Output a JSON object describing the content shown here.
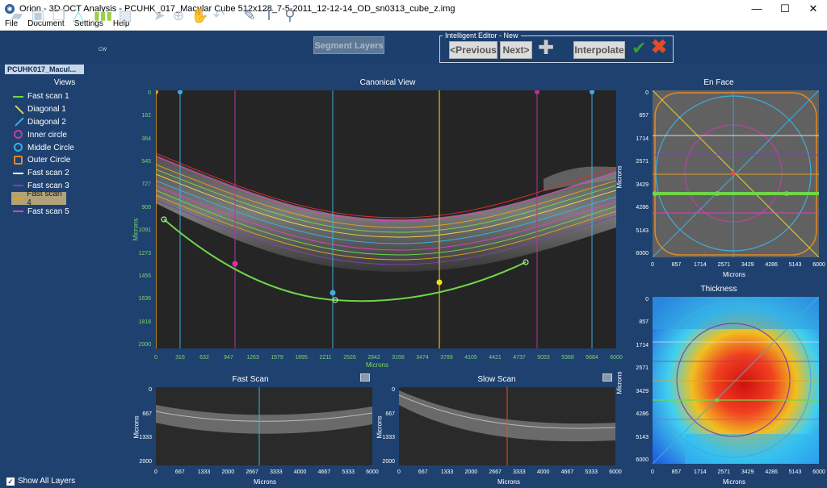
{
  "window": {
    "title": "Orion - 3D OCT Analysis - PCUHK_017_Macular Cube 512x128_7-5-2011_12-12-14_OD_sn0313_cube_z.img",
    "minimize": "—",
    "maximize": "☐",
    "close": "✕"
  },
  "menu": [
    "File",
    "Document",
    "Settings",
    "Help"
  ],
  "toolbar": {
    "segment_layers": "Segment Layers",
    "cw_label": "CW"
  },
  "editor": {
    "title": "Intelligent Editor - New",
    "previous": "<Previous",
    "next": "Next>",
    "interpolate": "Interpolate"
  },
  "doc_tab": "PCUHK017_Macul...",
  "views": {
    "title": "Views",
    "items": [
      {
        "label": "Fast scan 1",
        "color": "#6fd64a",
        "icon": "line-h"
      },
      {
        "label": "Diagonal 1",
        "color": "#e0d44a",
        "icon": "line-d"
      },
      {
        "label": "Diagonal 2",
        "color": "#3bb0e0",
        "icon": "line-d"
      },
      {
        "label": "Inner circle",
        "color": "#c040a0",
        "icon": "circle"
      },
      {
        "label": "Middle Circle",
        "color": "#3bb0e0",
        "icon": "circle"
      },
      {
        "label": "Outer Circle",
        "color": "#e08a2a",
        "icon": "square"
      },
      {
        "label": "Fast scan 2",
        "color": "#ffffff",
        "icon": "line-h"
      },
      {
        "label": "Fast scan 3",
        "color": "#8040b0",
        "icon": "line-h"
      },
      {
        "label": "Fast scan 4",
        "color": "#e0a020",
        "icon": "line-h",
        "selected": true
      },
      {
        "label": "Fast scan 5",
        "color": "#e040c0",
        "icon": "line-h"
      }
    ],
    "show_all": "Show All Layers"
  },
  "canonical": {
    "title": "Canonical View",
    "xlabel": "Microns",
    "ylabel": "Microns",
    "xticks": [
      "0",
      "316",
      "632",
      "947",
      "1263",
      "1579",
      "1895",
      "2211",
      "2526",
      "2842",
      "3158",
      "3474",
      "3789",
      "4105",
      "4421",
      "4737",
      "5053",
      "5368",
      "5684",
      "6000"
    ],
    "yticks": [
      "0",
      "182",
      "364",
      "545",
      "727",
      "909",
      "1091",
      "1273",
      "1455",
      "1636",
      "1818",
      "2000"
    ]
  },
  "fast_scan": {
    "title": "Fast Scan",
    "xlabel": "Microns",
    "ylabel": "Microns",
    "xticks": [
      "0",
      "667",
      "1333",
      "2000",
      "2667",
      "3333",
      "4000",
      "4667",
      "5333",
      "6000"
    ],
    "yticks": [
      "0",
      "667",
      "1333",
      "2000"
    ]
  },
  "slow_scan": {
    "title": "Slow Scan",
    "xlabel": "Microns",
    "ylabel": "Microns",
    "xticks": [
      "0",
      "667",
      "1333",
      "2000",
      "2667",
      "3333",
      "4000",
      "4667",
      "5333",
      "6000"
    ],
    "yticks": [
      "0",
      "667",
      "1333",
      "2000"
    ]
  },
  "en_face": {
    "title": "En Face",
    "xlabel": "Microns",
    "ylabel": "Microns",
    "xticks": [
      "0",
      "857",
      "1714",
      "2571",
      "3429",
      "4286",
      "5143",
      "6000"
    ],
    "yticks": [
      "0",
      "857",
      "1714",
      "2571",
      "3429",
      "4286",
      "5143",
      "6000"
    ]
  },
  "thickness": {
    "title": "Thickness",
    "xlabel": "Microns",
    "ylabel": "Microns",
    "xticks": [
      "0",
      "857",
      "1714",
      "2571",
      "3429",
      "4286",
      "5143",
      "6000"
    ],
    "yticks": [
      "0",
      "857",
      "1714",
      "2571",
      "3429",
      "4286",
      "5143",
      "6000"
    ]
  }
}
